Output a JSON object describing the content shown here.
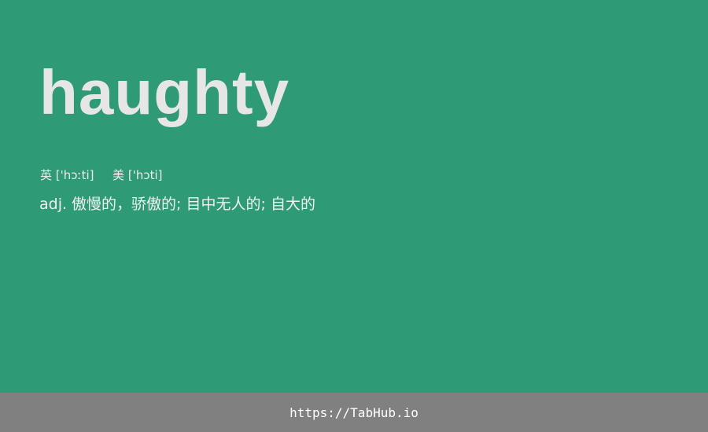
{
  "word": "haughty",
  "phonetics": {
    "uk_label": "英",
    "uk_ipa": "['hɔːti]",
    "us_label": "美",
    "us_ipa": "['hɔti]"
  },
  "definition": "adj. 傲慢的，骄傲的; 目中无人的; 自大的",
  "footer": {
    "link_text": "https://TabHub.io"
  },
  "colors": {
    "background": "#2e9b76",
    "footer_background": "#818080",
    "word_text": "#e6e6e6",
    "footer_text": "#ffffff"
  }
}
